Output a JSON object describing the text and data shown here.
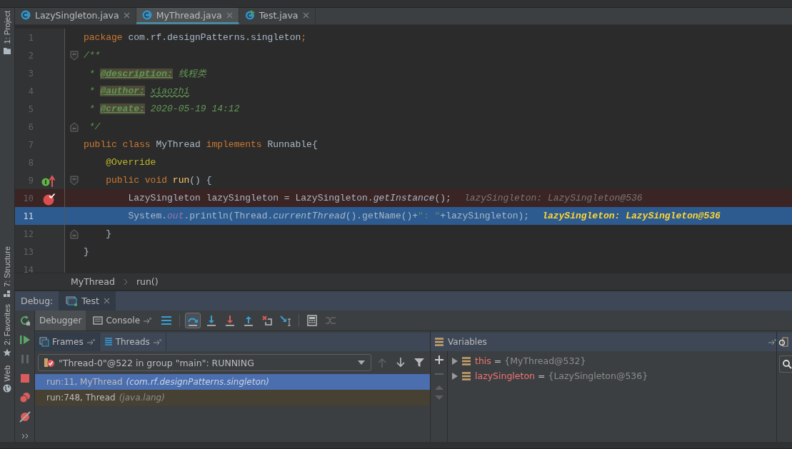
{
  "tool_windows_left": [
    {
      "label": "1: Project",
      "kind": "folder"
    },
    {
      "label": "7: Structure",
      "kind": "structure"
    },
    {
      "label": "2: Favorites",
      "kind": "star"
    },
    {
      "label": "Web",
      "kind": "globe"
    }
  ],
  "editor_tabs": [
    {
      "label": "LazySingleton.java",
      "kind": "class",
      "selected": false
    },
    {
      "label": "MyThread.java",
      "kind": "class",
      "selected": true
    },
    {
      "label": "Test.java",
      "kind": "runnable",
      "selected": false
    }
  ],
  "code_lines": [
    {
      "number": "1",
      "selected": false,
      "breakpoint": false,
      "tokens": [
        {
          "kind": "kw",
          "text": "package "
        },
        {
          "kind": "plain",
          "text": "com.rf.designPatterns.singleton"
        },
        {
          "kind": "kw",
          "text": ";"
        }
      ]
    },
    {
      "number": "2",
      "selected": false,
      "breakpoint": false,
      "gutter": [
        {
          "kind": "fold-start"
        }
      ],
      "tokens": [
        {
          "kind": "comment",
          "text": "/**"
        }
      ]
    },
    {
      "number": "3",
      "selected": false,
      "breakpoint": false,
      "tokens": [
        {
          "kind": "comment",
          "text": " * "
        },
        {
          "kind": "doctag",
          "text": "@description:"
        },
        {
          "kind": "comment",
          "text": " 线程类"
        }
      ]
    },
    {
      "number": "4",
      "selected": false,
      "breakpoint": false,
      "tokens": [
        {
          "kind": "comment",
          "text": " * "
        },
        {
          "kind": "doctag",
          "text": "@author:"
        },
        {
          "kind": "docvalue",
          "text": "xiaozhi"
        }
      ]
    },
    {
      "number": "5",
      "selected": false,
      "breakpoint": false,
      "tokens": [
        {
          "kind": "comment",
          "text": " * "
        },
        {
          "kind": "doctag",
          "text": "@create:"
        },
        {
          "kind": "comment",
          "text": " 2020-05-19 14:12"
        }
      ]
    },
    {
      "number": "6",
      "selected": false,
      "breakpoint": false,
      "gutter": [
        {
          "kind": "fold-end"
        }
      ],
      "tokens": [
        {
          "kind": "comment",
          "text": " */"
        }
      ]
    },
    {
      "number": "7",
      "selected": false,
      "breakpoint": false,
      "tokens": [
        {
          "kind": "kw",
          "text": "public class "
        },
        {
          "kind": "plain",
          "text": "MyThread "
        },
        {
          "kind": "kw",
          "text": "implements "
        },
        {
          "kind": "plain",
          "text": "Runnable{"
        }
      ]
    },
    {
      "number": "8",
      "selected": false,
      "breakpoint": false,
      "tokens": [
        {
          "kind": "ann",
          "text": "    @Override"
        }
      ]
    },
    {
      "number": "9",
      "selected": false,
      "breakpoint": false,
      "gutter": [
        {
          "kind": "override"
        },
        {
          "kind": "fold-start"
        }
      ],
      "tokens": [
        {
          "kind": "kw",
          "text": "    public void "
        },
        {
          "kind": "method",
          "text": "run"
        },
        {
          "kind": "plain",
          "text": "() {"
        }
      ]
    },
    {
      "number": "10",
      "selected": false,
      "breakpoint": true,
      "tokens": [
        {
          "kind": "plain",
          "text": "        LazySingleton lazySingleton = LazySingleton."
        },
        {
          "kind": "italic",
          "text": "getInstance"
        },
        {
          "kind": "plain",
          "text": "();"
        },
        {
          "kind": "hint",
          "text": "lazySingleton: LazySingleton@536"
        }
      ]
    },
    {
      "number": "11",
      "selected": true,
      "breakpoint": false,
      "tokens": [
        {
          "kind": "plain",
          "text": "        System."
        },
        {
          "kind": "static",
          "text": "out"
        },
        {
          "kind": "plain",
          "text": ".println(Thread."
        },
        {
          "kind": "italic",
          "text": "currentThread"
        },
        {
          "kind": "plain",
          "text": "().getName()+"
        },
        {
          "kind": "str",
          "text": "\": \""
        },
        {
          "kind": "plain",
          "text": "+lazySingleton);"
        },
        {
          "kind": "hint",
          "text": "lazySingleton: LazySingleton@536"
        }
      ]
    },
    {
      "number": "12",
      "selected": false,
      "breakpoint": false,
      "gutter": [
        {
          "kind": "fold-end"
        }
      ],
      "tokens": [
        {
          "kind": "plain",
          "text": "    }"
        }
      ]
    },
    {
      "number": "13",
      "selected": false,
      "breakpoint": false,
      "tokens": [
        {
          "kind": "plain",
          "text": "}"
        }
      ]
    },
    {
      "number": "14",
      "selected": false,
      "breakpoint": false
    }
  ],
  "breadcrumb": [
    "MyThread",
    "run()"
  ],
  "debug": {
    "title": "Debug:",
    "session_tab": "Test",
    "tabs": [
      {
        "label": "Debugger",
        "selected": true
      },
      {
        "label": "Console",
        "selected": false
      }
    ],
    "toolbar": [
      {
        "kind": "frames"
      },
      {
        "kind": "sep"
      },
      {
        "kind": "step-over",
        "selected": true
      },
      {
        "kind": "step-into",
        "selected": false
      },
      {
        "kind": "force-step-into",
        "selected": false
      },
      {
        "kind": "step-out",
        "selected": false
      },
      {
        "kind": "drop-frame",
        "selected": false
      },
      {
        "kind": "run-to-cursor",
        "selected": false
      },
      {
        "kind": "sep"
      },
      {
        "kind": "evaluate",
        "selected": false
      },
      {
        "kind": "trace",
        "selected": false
      }
    ],
    "side_buttons": [
      {
        "kind": "rerun",
        "disabled": false
      },
      {
        "kind": "resume",
        "disabled": false
      },
      {
        "kind": "pause",
        "disabled": true
      },
      {
        "kind": "stop",
        "disabled": false
      },
      {
        "kind": "breakpoints",
        "disabled": false
      },
      {
        "kind": "mute",
        "disabled": false
      },
      {
        "kind": "more",
        "disabled": false
      }
    ],
    "frame_tabs": [
      {
        "label": "Frames",
        "selected": true
      },
      {
        "label": "Threads",
        "selected": false
      }
    ],
    "thread": "\"Thread-0\"@522 in group \"main\": RUNNING",
    "frames": [
      {
        "location": "run:11, MyThread",
        "package": "(com.rf.designPatterns.singleton)",
        "selected": true
      },
      {
        "location": "run:748, Thread",
        "package": "(java.lang)",
        "selected": false
      }
    ],
    "variables_title": "Variables",
    "variables": [
      {
        "name": "this",
        "operator": "=",
        "value": "{MyThread@532}",
        "expanded": false
      },
      {
        "name": "lazySingleton",
        "operator": "=",
        "value": "{LazySingleton@536}",
        "expanded": false
      }
    ]
  }
}
